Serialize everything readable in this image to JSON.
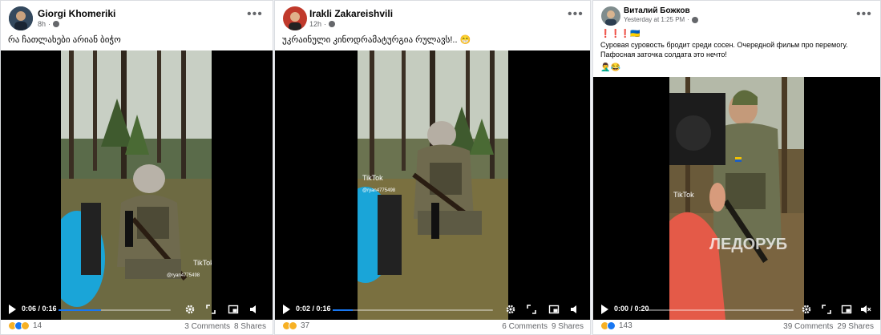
{
  "colors": {
    "accent": "#1877f2",
    "muted": "#65676b",
    "text": "#050505"
  },
  "posts": [
    {
      "author": "Giorgi Khomeriki",
      "time": "8h",
      "text_lines": [
        "რა ჩათლახები არიან ბიჭო"
      ],
      "video": {
        "time": "0:06 / 0:16",
        "progress": 0.375,
        "watermark": "TikTok",
        "watermark_user": "@ryan4775498"
      },
      "reactions": [
        "haha",
        "like",
        "wow"
      ],
      "reaction_count": "14",
      "comments": "3 Comments",
      "shares": "8 Shares"
    },
    {
      "author": "Irakli Zakareishvili",
      "time": "12h",
      "text_lines": [
        "უკრაინული კინოდრამატურგია რულავს!.. 😁"
      ],
      "video": {
        "time": "0:02 / 0:16",
        "progress": 0.125,
        "watermark": "TikTok",
        "watermark_user": "@ryan4775498"
      },
      "reactions": [
        "haha",
        "wow"
      ],
      "reaction_count": "37",
      "comments": "6 Comments",
      "shares": "9 Shares"
    },
    {
      "author": "Виталий Божков",
      "time": "Yesterday at 1:25 PM",
      "text_lines": [
        "❗❗❗🇺🇦",
        "Суровая суровость бродит среди сосен. Очередной фильм про перемогу.",
        "Пафосная заточка солдата это нечто!",
        "🤦‍♂️😂"
      ],
      "video": {
        "time": "0:00 / 0:20",
        "progress": 0.0,
        "watermark": "TikTok",
        "overlay_text": "ЛЕДОРУБ"
      },
      "reactions": [
        "haha",
        "like"
      ],
      "reaction_count": "143",
      "comments": "39 Comments",
      "shares": "29 Shares"
    }
  ]
}
